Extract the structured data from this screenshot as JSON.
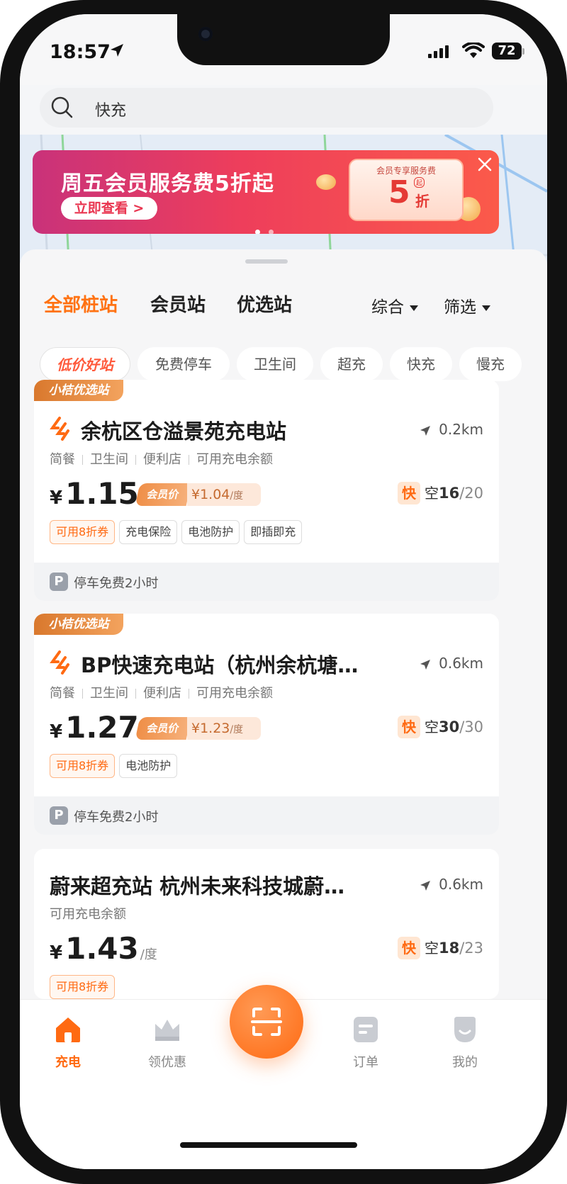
{
  "status_bar": {
    "time": "18:57",
    "battery": "72"
  },
  "search": {
    "query": "快充"
  },
  "banner": {
    "title": "周五会员服务费5折起",
    "button": "立即查看 >",
    "badge_label": "会员专享服务费",
    "badge_value": "5",
    "badge_suffix": "折",
    "badge_qi": "起",
    "page_count": 2,
    "active_page": 1
  },
  "tabs": [
    "全部桩站",
    "会员站",
    "优选站"
  ],
  "active_tab": 0,
  "sort_options": {
    "sort": "综合",
    "filter": "筛选"
  },
  "chips": [
    "低价好站",
    "免费停车",
    "卫生间",
    "超充",
    "快充",
    "慢充"
  ],
  "stations": [
    {
      "tag": "小桔优选站",
      "name": "余杭区仓溢景苑充电站",
      "distance": "0.2km",
      "amenities": [
        "简餐",
        "卫生间",
        "便利店",
        "可用充电余额"
      ],
      "price_yen": "¥",
      "price": "1.15",
      "member_label": "会员价",
      "member_price": "¥1.04",
      "member_unit": "/度",
      "charger_type": "快",
      "avail_prefix": "空",
      "avail_free": "16",
      "avail_total": "/20",
      "tags": [
        "可用8折券",
        "充电保险",
        "电池防护",
        "即插即充"
      ],
      "parking_icon": "P",
      "parking": "停车免费2小时"
    },
    {
      "tag": "小桔优选站",
      "name": "BP快速充电站（杭州余杭塘…",
      "distance": "0.6km",
      "amenities": [
        "简餐",
        "卫生间",
        "便利店",
        "可用充电余额"
      ],
      "price_yen": "¥",
      "price": "1.27",
      "member_label": "会员价",
      "member_price": "¥1.23",
      "member_unit": "/度",
      "charger_type": "快",
      "avail_prefix": "空",
      "avail_free": "30",
      "avail_total": "/30",
      "tags": [
        "可用8折券",
        "电池防护"
      ],
      "parking_icon": "P",
      "parking": "停车免费2小时"
    },
    {
      "name": "蔚来超充站 杭州未来科技城蔚…",
      "distance": "0.6km",
      "amenities": [
        "可用充电余额"
      ],
      "price_yen": "¥",
      "price": "1.43",
      "price_unit": "/度",
      "charger_type": "快",
      "avail_prefix": "空",
      "avail_free": "18",
      "avail_total": "/23",
      "tags": [
        "可用8折券"
      ]
    }
  ],
  "tabbar": [
    {
      "label": "充电",
      "icon": "home-icon"
    },
    {
      "label": "领优惠",
      "icon": "crown-icon"
    },
    {
      "label": "订单",
      "icon": "order-icon"
    },
    {
      "label": "我的",
      "icon": "profile-icon"
    }
  ],
  "active_tabbar": 0,
  "colors": {
    "accent": "#ff6a12",
    "banner_start": "#c9327a",
    "banner_end": "#fb5a4a"
  }
}
